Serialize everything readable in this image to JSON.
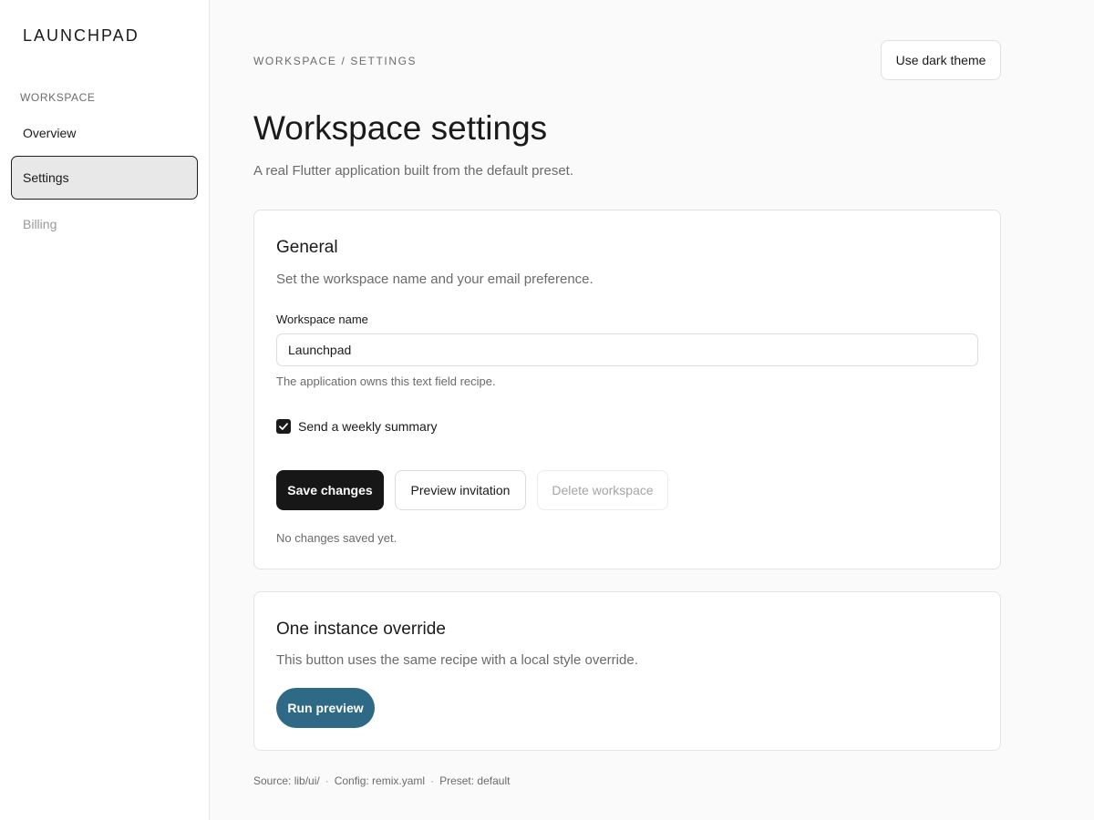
{
  "sidebar": {
    "brand": "LAUNCHPAD",
    "section_label": "WORKSPACE",
    "items": [
      {
        "label": "Overview",
        "state": "default"
      },
      {
        "label": "Settings",
        "state": "active"
      },
      {
        "label": "Billing",
        "state": "disabled"
      }
    ]
  },
  "header": {
    "breadcrumb": "WORKSPACE / SETTINGS",
    "theme_button": "Use dark theme",
    "title": "Workspace settings",
    "subtitle": "A real Flutter application built from the default preset."
  },
  "general": {
    "title": "General",
    "description": "Set the workspace name and your email preference.",
    "field_label": "Workspace name",
    "field_value": "Launchpad",
    "helper": "The application owns this text field recipe.",
    "checkbox_label": "Send a weekly summary",
    "checkbox_checked": true,
    "save_label": "Save changes",
    "preview_label": "Preview invitation",
    "delete_label": "Delete workspace",
    "status": "No changes saved yet."
  },
  "override": {
    "title": "One instance override",
    "description": "This button uses the same recipe with a local style override.",
    "run_label": "Run preview"
  },
  "footer": {
    "source": "Source: lib/ui/",
    "config": "Config: remix.yaml",
    "preset": "Preset: default",
    "separator": "·"
  },
  "colors": {
    "primary": "#171717",
    "accent": "#2e6a86",
    "muted_text": "#6b6b6b",
    "background": "#fafafa"
  }
}
